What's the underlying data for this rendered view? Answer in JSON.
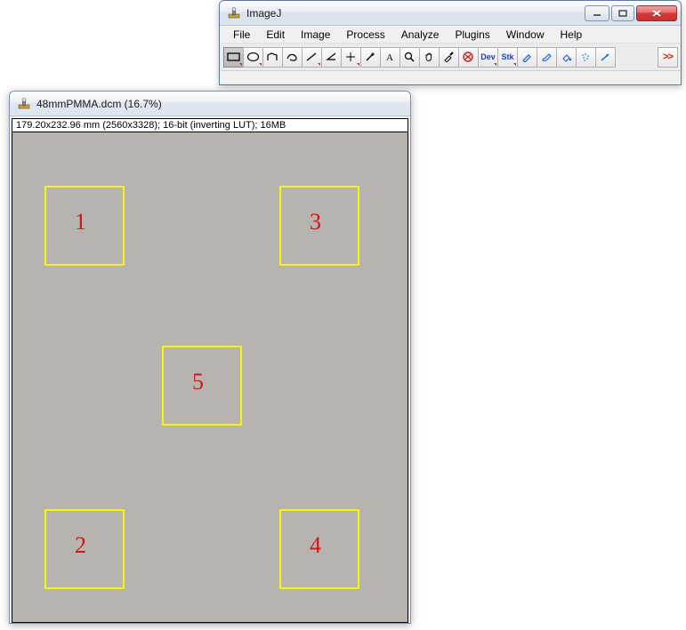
{
  "imagej": {
    "title": "ImageJ",
    "menu": {
      "file": "File",
      "edit": "Edit",
      "image": "Image",
      "process": "Process",
      "analyze": "Analyze",
      "plugins": "Plugins",
      "window": "Window",
      "help": "Help"
    },
    "tools": {
      "dev": "Dev",
      "stk": "Stk",
      "more": ">>"
    }
  },
  "image_win": {
    "title": "48mmPMMA.dcm (16.7%)",
    "info": "179.20x232.96 mm (2560x3328); 16-bit (inverting LUT); 16MB",
    "rois": {
      "r1": "1",
      "r2": "2",
      "r3": "3",
      "r4": "4",
      "r5": "5"
    }
  }
}
